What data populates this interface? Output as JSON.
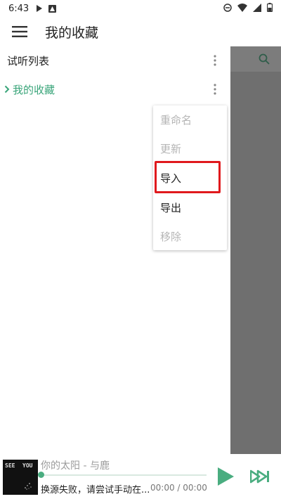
{
  "status_bar": {
    "time": "6:43"
  },
  "app_bar": {
    "title": "我的收藏"
  },
  "drawer": {
    "items": [
      {
        "label": "试听列表"
      },
      {
        "label": "我的收藏"
      }
    ]
  },
  "context_menu": {
    "items": [
      {
        "label": "重命名",
        "enabled": false
      },
      {
        "label": "更新",
        "enabled": false
      },
      {
        "label": "导入",
        "enabled": true
      },
      {
        "label": "导出",
        "enabled": true
      },
      {
        "label": "移除",
        "enabled": false
      }
    ]
  },
  "player": {
    "cover_text_1": "SEE",
    "cover_text_2": "YOU",
    "song_title": "你的太阳 - 与鹿",
    "status": "换源失败，请尝试手动在...",
    "time": "00:00 / 00:00",
    "progress": 0
  },
  "colors": {
    "accent": "#3aa57a",
    "highlight": "#e0191d",
    "dim": "#6f6f6f"
  }
}
